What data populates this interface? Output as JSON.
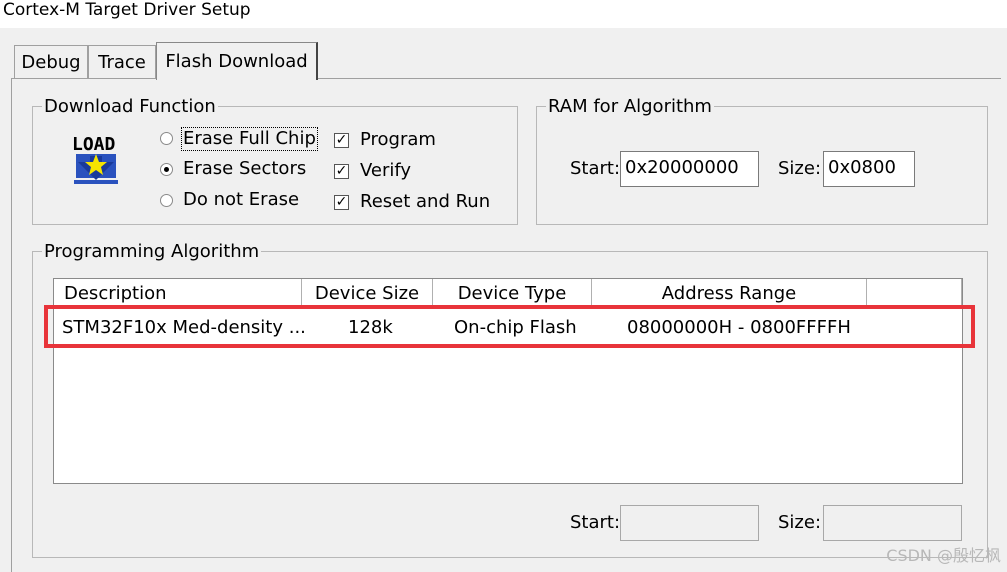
{
  "window": {
    "title": "Cortex-M Target Driver Setup"
  },
  "tabs": [
    {
      "label": "Debug"
    },
    {
      "label": "Trace"
    },
    {
      "label": "Flash Download"
    }
  ],
  "download_function": {
    "legend": "Download Function",
    "icon": "load-icon",
    "radios": [
      {
        "label": "Erase Full Chip",
        "checked": false
      },
      {
        "label": "Erase Sectors",
        "checked": true
      },
      {
        "label": "Do not Erase",
        "checked": false
      }
    ],
    "checks": [
      {
        "label": "Program",
        "checked": true
      },
      {
        "label": "Verify",
        "checked": true
      },
      {
        "label": "Reset and Run",
        "checked": true
      }
    ]
  },
  "ram_for_algorithm": {
    "legend": "RAM for Algorithm",
    "start_label": "Start:",
    "start_value": "0x20000000",
    "size_label": "Size:",
    "size_value": "0x0800"
  },
  "programming_algorithm": {
    "legend": "Programming Algorithm",
    "columns": [
      "Description",
      "Device Size",
      "Device Type",
      "Address Range"
    ],
    "rows": [
      {
        "description": "STM32F10x Med-density ...",
        "device_size": "128k",
        "device_type": "On-chip Flash",
        "address_range": "08000000H - 0800FFFFH"
      }
    ],
    "start_label": "Start:",
    "start_value": "",
    "size_label": "Size:",
    "size_value": ""
  },
  "watermark": "CSDN @殷忆枫",
  "colors": {
    "highlight": "#e8343a",
    "dialog_bg": "#f0f0f0"
  }
}
